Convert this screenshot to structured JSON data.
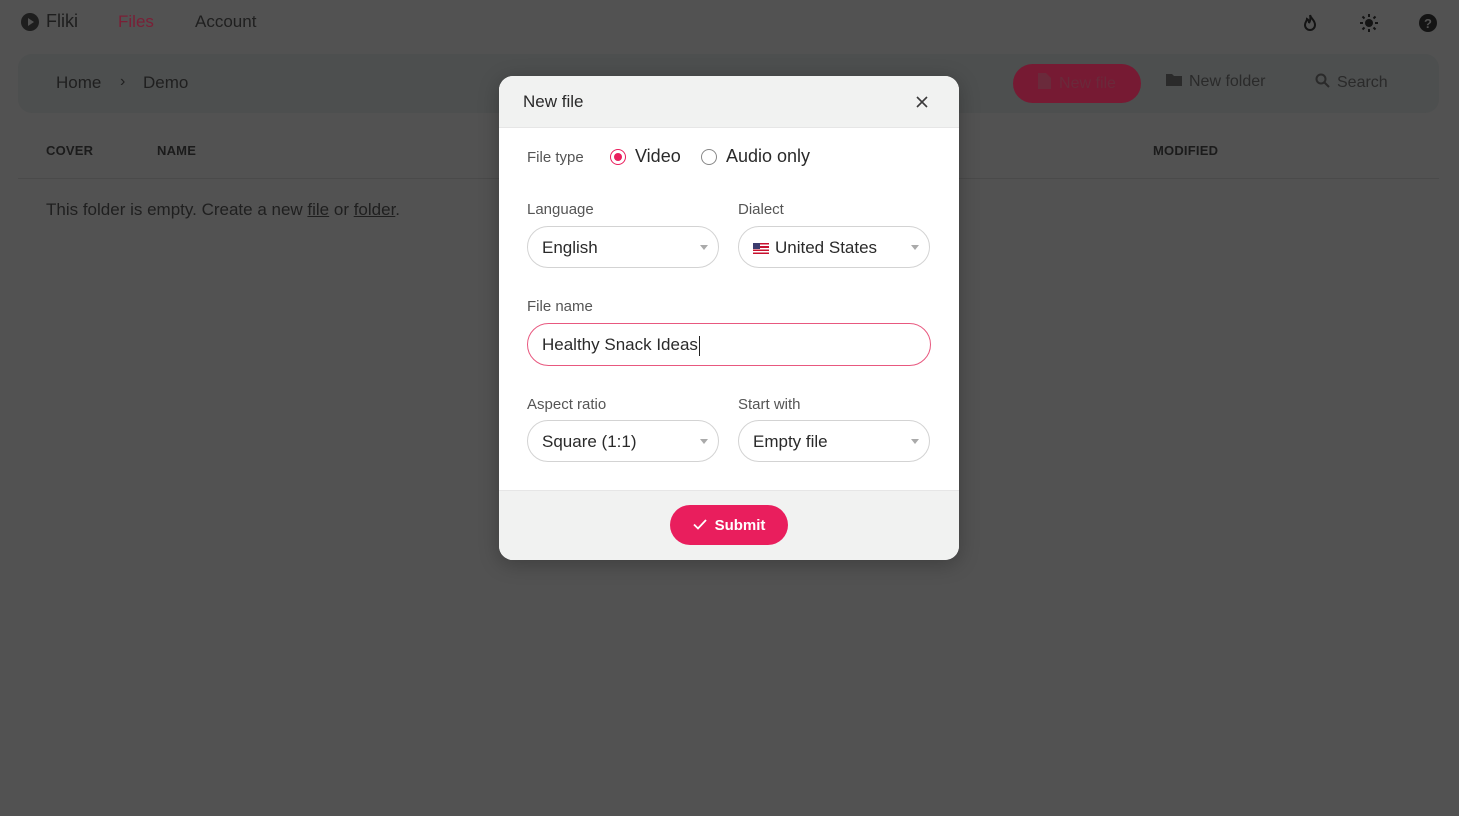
{
  "nav": {
    "brand": "Fliki",
    "links": [
      "Files",
      "Account"
    ]
  },
  "breadcrumb": {
    "home": "Home",
    "separator": "›",
    "current": "Demo"
  },
  "toolbar": {
    "new_file": "New file",
    "new_folder": "New folder",
    "search": "Search"
  },
  "table": {
    "columns": [
      "COVER",
      "NAME",
      "MODIFIED"
    ]
  },
  "empty_state": {
    "prefix": "This folder is empty. Create a new ",
    "file_link": "file",
    "middle": " or ",
    "folder_link": "folder",
    "suffix": "."
  },
  "modal": {
    "title": "New file",
    "file_type_label": "File type",
    "file_type_options": [
      "Video",
      "Audio only"
    ],
    "file_type_selected": "Video",
    "language_label": "Language",
    "language_value": "English",
    "dialect_label": "Dialect",
    "dialect_value": "United States",
    "file_name_label": "File name",
    "file_name_value": "Healthy Snack Ideas",
    "aspect_label": "Aspect ratio",
    "aspect_value": "Square (1:1)",
    "start_label": "Start with",
    "start_value": "Empty file",
    "submit_label": "Submit"
  },
  "colors": {
    "accent": "#e91e5d",
    "overlay_bg": "#525252",
    "modal_bg": "#ffffff",
    "modal_band": "#f1f2f1"
  },
  "icons": [
    "fliki-logo-icon",
    "fire-icon",
    "sun-icon",
    "help-icon",
    "new-file-icon",
    "new-folder-icon",
    "search-icon",
    "close-icon",
    "check-icon",
    "chevron-down-icon"
  ]
}
